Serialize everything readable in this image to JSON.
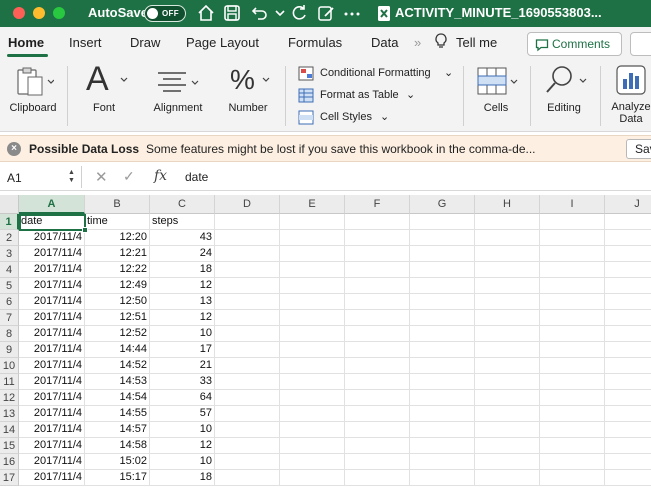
{
  "window": {
    "autosave_label": "AutoSave",
    "autosave_state": "OFF",
    "title": "ACTIVITY_MINUTE_1690553803...",
    "accent": "#1e7145"
  },
  "ribbon_tabs": [
    "Home",
    "Insert",
    "Draw",
    "Page Layout",
    "Formulas",
    "Data",
    "Tell me"
  ],
  "comments_label": "Comments",
  "ribbon": {
    "clipboard": "Clipboard",
    "font": "Font",
    "alignment": "Alignment",
    "number": "Number",
    "conditional_formatting": "Conditional Formatting",
    "format_as_table": "Format as Table",
    "cell_styles": "Cell Styles",
    "cells": "Cells",
    "editing": "Editing",
    "analyze_1": "Analyze",
    "analyze_2": "Data"
  },
  "message_bar": {
    "title": "Possible Data Loss",
    "body": "Some features might be lost if you save this workbook in the comma-de...",
    "button": "Sav"
  },
  "formula_bar": {
    "name_box": "A1",
    "fx": "fx",
    "value": "date"
  },
  "sheet": {
    "columns": [
      "A",
      "B",
      "C",
      "D",
      "E",
      "F",
      "G",
      "H",
      "I",
      "J"
    ],
    "rows": [
      [
        "date",
        "time",
        "steps"
      ],
      [
        "2017/11/4",
        "12:20",
        "43"
      ],
      [
        "2017/11/4",
        "12:21",
        "24"
      ],
      [
        "2017/11/4",
        "12:22",
        "18"
      ],
      [
        "2017/11/4",
        "12:49",
        "12"
      ],
      [
        "2017/11/4",
        "12:50",
        "13"
      ],
      [
        "2017/11/4",
        "12:51",
        "12"
      ],
      [
        "2017/11/4",
        "12:52",
        "10"
      ],
      [
        "2017/11/4",
        "14:44",
        "17"
      ],
      [
        "2017/11/4",
        "14:52",
        "21"
      ],
      [
        "2017/11/4",
        "14:53",
        "33"
      ],
      [
        "2017/11/4",
        "14:54",
        "64"
      ],
      [
        "2017/11/4",
        "14:55",
        "57"
      ],
      [
        "2017/11/4",
        "14:57",
        "10"
      ],
      [
        "2017/11/4",
        "14:58",
        "12"
      ],
      [
        "2017/11/4",
        "15:02",
        "10"
      ],
      [
        "2017/11/4",
        "15:17",
        "18"
      ]
    ]
  }
}
